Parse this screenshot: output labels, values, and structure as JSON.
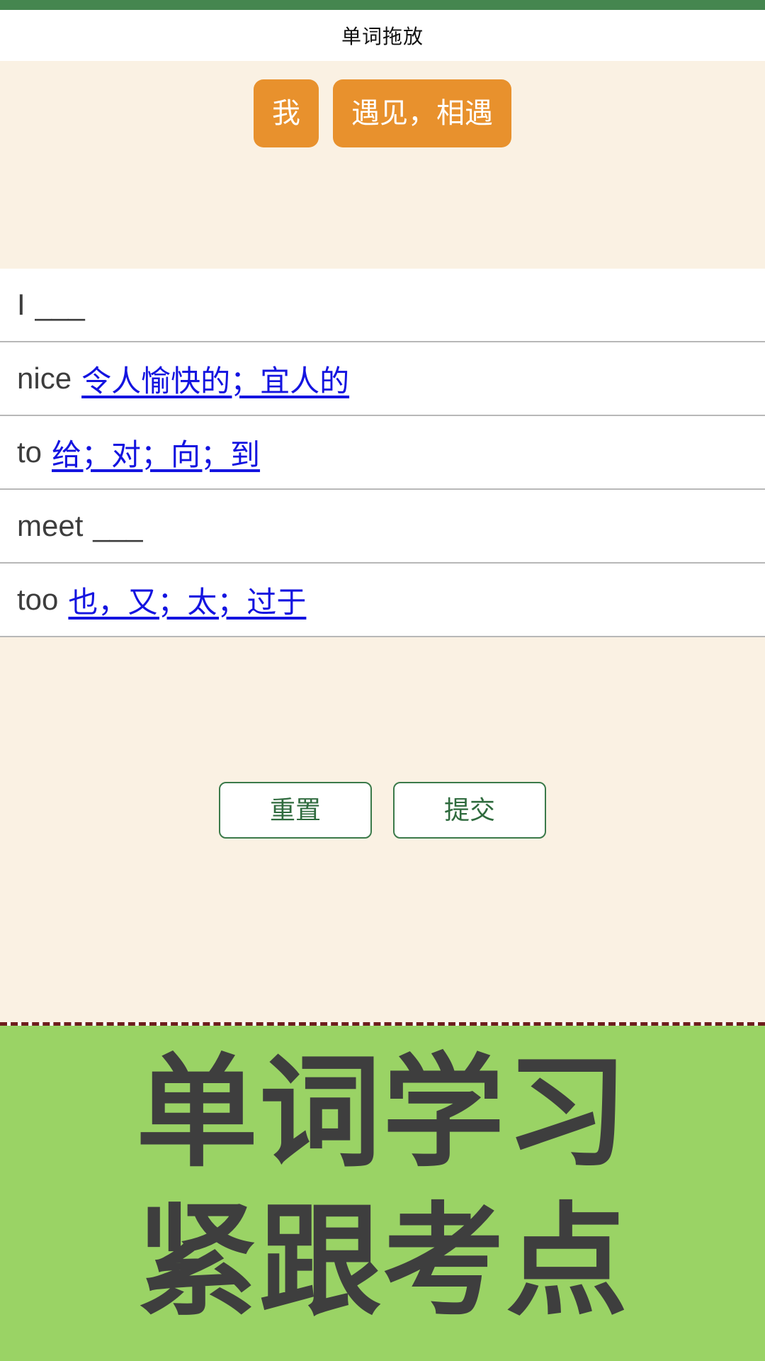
{
  "header": {
    "title": "单词拖放",
    "accent_color": "#45864f"
  },
  "word_bank": {
    "background_color": "#faf1e3",
    "chip_color": "#e8912d",
    "chips": [
      {
        "label": "我"
      },
      {
        "label": "遇见，相遇"
      }
    ]
  },
  "rows": [
    {
      "en": "I",
      "zh": "",
      "blank": "___",
      "filled": false
    },
    {
      "en": "nice",
      "zh": "令人愉快的；宜人的",
      "blank": "",
      "filled": true
    },
    {
      "en": "to",
      "zh": "给；对；向；到",
      "blank": "",
      "filled": true
    },
    {
      "en": "meet",
      "zh": "",
      "blank": "___",
      "filled": false
    },
    {
      "en": "too",
      "zh": "也，又；太；过于",
      "blank": "",
      "filled": true
    }
  ],
  "actions": {
    "reset_label": "重置",
    "submit_label": "提交",
    "button_color": "#2f6b3e"
  },
  "banner": {
    "background_color": "#9ad365",
    "text_color": "#3e3e3e",
    "line1": "单词学习",
    "line2": "紧跟考点"
  }
}
